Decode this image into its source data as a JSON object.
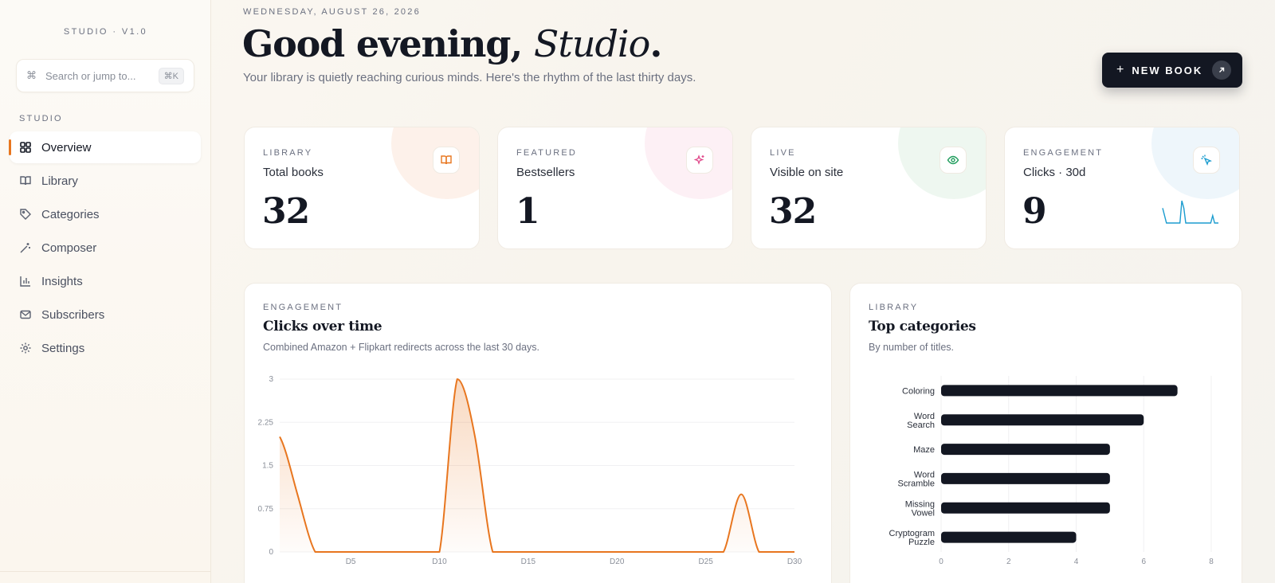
{
  "sidebar": {
    "brand": "STUDIO · V1.0",
    "search": {
      "placeholder": "Search or jump to...",
      "shortcut": "⌘K"
    },
    "section_label": "STUDIO",
    "items": [
      {
        "label": "Overview",
        "icon": "grid-icon",
        "active": true
      },
      {
        "label": "Library",
        "icon": "book-icon",
        "active": false
      },
      {
        "label": "Categories",
        "icon": "tag-icon",
        "active": false
      },
      {
        "label": "Composer",
        "icon": "wand-icon",
        "active": false
      },
      {
        "label": "Insights",
        "icon": "bar-chart-icon",
        "active": false
      },
      {
        "label": "Subscribers",
        "icon": "mail-icon",
        "active": false
      },
      {
        "label": "Settings",
        "icon": "gear-icon",
        "active": false
      }
    ]
  },
  "header": {
    "date": "WEDNESDAY, AUGUST 26, 2026",
    "greeting": "Good evening,",
    "greeting_name": "Studio",
    "greeting_end": ".",
    "subtitle": "Your library is quietly reaching curious minds. Here's the rhythm of the last thirty days.",
    "new_book_label": "NEW BOOK"
  },
  "stats": [
    {
      "eyebrow": "LIBRARY",
      "name": "Total books",
      "value": "32",
      "icon": "book-icon",
      "color": "#e8761f",
      "tint": "#fdf1ea"
    },
    {
      "eyebrow": "FEATURED",
      "name": "Bestsellers",
      "value": "1",
      "icon": "sparkle-icon",
      "color": "#e0488a",
      "tint": "#fdf0f5"
    },
    {
      "eyebrow": "LIVE",
      "name": "Visible on site",
      "value": "32",
      "icon": "eye-icon",
      "color": "#1f9d5c",
      "tint": "#eef7f0"
    },
    {
      "eyebrow": "ENGAGEMENT",
      "name": "Clicks · 30d",
      "value": "9",
      "icon": "cursor-click-icon",
      "color": "#1b9ccf",
      "tint": "#eef6fb"
    }
  ],
  "clicks_panel": {
    "eyebrow": "ENGAGEMENT",
    "title": "Clicks over time",
    "subtitle": "Combined Amazon + Flipkart redirects across the last 30 days."
  },
  "categories_panel": {
    "eyebrow": "LIBRARY",
    "title": "Top categories",
    "subtitle": "By number of titles."
  },
  "chart_data": [
    {
      "type": "area",
      "title": "Clicks over time",
      "x": [
        "D1",
        "D2",
        "D3",
        "D4",
        "D5",
        "D6",
        "D7",
        "D8",
        "D9",
        "D10",
        "D11",
        "D12",
        "D13",
        "D14",
        "D15",
        "D16",
        "D17",
        "D18",
        "D19",
        "D20",
        "D21",
        "D22",
        "D23",
        "D24",
        "D25",
        "D26",
        "D27",
        "D28",
        "D29",
        "D30"
      ],
      "xticks": [
        "D5",
        "D10",
        "D15",
        "D20",
        "D25",
        "D30"
      ],
      "values": [
        2,
        1,
        0,
        0,
        0,
        0,
        0,
        0,
        0,
        0,
        3,
        2,
        0,
        0,
        0,
        0,
        0,
        0,
        0,
        0,
        0,
        0,
        0,
        0,
        0,
        0,
        1,
        0,
        0,
        0
      ],
      "ylim": [
        0,
        3
      ],
      "yticks": [
        "0",
        "0.75",
        "1.5",
        "2.25",
        "3"
      ],
      "grid": true,
      "color": "#e8761f"
    },
    {
      "type": "bar",
      "orientation": "horizontal",
      "title": "Top categories",
      "categories": [
        [
          "Coloring"
        ],
        [
          "Word",
          "Search"
        ],
        [
          "Maze"
        ],
        [
          "Word",
          "Scramble"
        ],
        [
          "Missing",
          "Vowel"
        ],
        [
          "Cryptogram",
          "Puzzle"
        ]
      ],
      "values": [
        7,
        6,
        5,
        5,
        5,
        4
      ],
      "xlim": [
        0,
        8
      ],
      "xticks": [
        "0",
        "2",
        "4",
        "6",
        "8"
      ],
      "grid": true,
      "color": "#131722"
    }
  ]
}
